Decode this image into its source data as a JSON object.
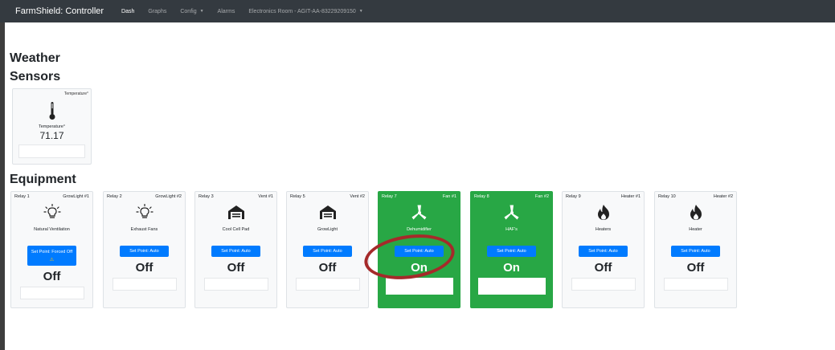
{
  "navbar": {
    "brand": "FarmShield: Controller",
    "items": [
      {
        "label": "Dash",
        "active": true
      },
      {
        "label": "Graphs"
      },
      {
        "label": "Config",
        "dropdown": true
      },
      {
        "label": "Alarms"
      },
      {
        "label": "Electronics Room - AGIT-AA-83229209150",
        "dropdown": true
      }
    ]
  },
  "sections": {
    "weather": "Weather",
    "sensors": "Sensors",
    "equipment": "Equipment"
  },
  "sensor": {
    "corner_label": "Temperature°",
    "label": "Temperature°",
    "value": "71.17",
    "icon": "thermometer-icon"
  },
  "equipment": [
    {
      "relay": "Relay 1",
      "kind": "GrowLight #1",
      "name": "Natural Ventilation",
      "set_point": "Set Point: Forced Off",
      "warning": "⚠",
      "state": "Off",
      "icon": "lightbulb-icon",
      "on": false
    },
    {
      "relay": "Relay 2",
      "kind": "GrowLight #2",
      "name": "Exhaust Fans",
      "set_point": "Set Point: Auto",
      "state": "Off",
      "icon": "lightbulb-icon",
      "on": false
    },
    {
      "relay": "Relay 3",
      "kind": "Vent #1",
      "name": "Cool Cell Pad",
      "set_point": "Set Point: Auto",
      "state": "Off",
      "icon": "vent-icon",
      "on": false
    },
    {
      "relay": "Relay 5",
      "kind": "Vent #2",
      "name": "GrowLight",
      "set_point": "Set Point: Auto",
      "state": "Off",
      "icon": "vent-icon",
      "on": false
    },
    {
      "relay": "Relay 7",
      "kind": "Fan #1",
      "name": "Dehumidifier",
      "set_point": "Set Point: Auto",
      "state": "On",
      "icon": "fan-icon",
      "on": true
    },
    {
      "relay": "Relay 8",
      "kind": "Fan #2",
      "name": "HAF's",
      "set_point": "Set Point: Auto",
      "state": "On",
      "icon": "fan-icon",
      "on": true
    },
    {
      "relay": "Relay 9",
      "kind": "Heater #1",
      "name": "Heaters",
      "set_point": "Set Point: Auto",
      "state": "Off",
      "icon": "flame-icon",
      "on": false
    },
    {
      "relay": "Relay 10",
      "kind": "Heater #2",
      "name": "Heater",
      "set_point": "Set Point: Auto",
      "state": "Off",
      "icon": "flame-icon",
      "on": false
    }
  ],
  "colors": {
    "navbar": "#343a40",
    "card": "#f8f9fa",
    "on": "#28a745",
    "button": "#007bff",
    "annotation": "#a52a2a"
  }
}
